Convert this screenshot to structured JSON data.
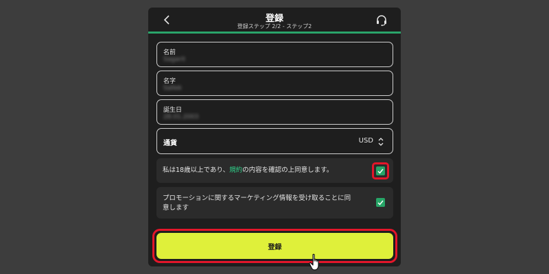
{
  "header": {
    "title": "登録",
    "subtitle": "登録ステップ 2/2 - ステップ2",
    "back_icon": "chevron-left-icon",
    "support_icon": "headset-icon"
  },
  "form": {
    "first_name": {
      "label": "名前",
      "value": "Sagarit"
    },
    "last_name": {
      "label": "名字",
      "value": "Sallek"
    },
    "birthday": {
      "label": "誕生日",
      "value": "28.01.2003"
    },
    "currency": {
      "label": "通貨",
      "value": "USD",
      "icon": "chevron-up-down-icon"
    }
  },
  "checkboxes": {
    "terms": {
      "text_before": "私は18歳以上であり、",
      "link": "規約",
      "text_after": "の内容を確認の上同意します。",
      "checked": true
    },
    "promotions": {
      "line1": "プロモーションに関するマーケティング情報を受け取ることに同",
      "line2": "意します",
      "checked": true
    }
  },
  "submit": {
    "label": "登録"
  },
  "colors": {
    "accent_green": "#2aa56a",
    "link_green": "#2fd18a",
    "button_yellow": "#dff03a",
    "highlight_red": "#e4162a",
    "panel_bg": "#1e1e1e",
    "page_bg": "#3d3d3d"
  }
}
